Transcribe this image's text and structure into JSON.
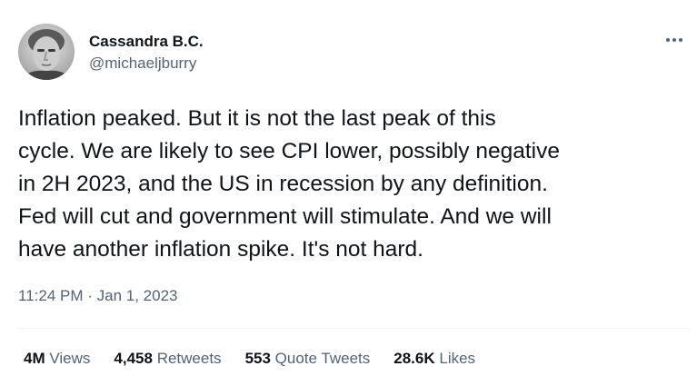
{
  "author": {
    "display_name": "Cassandra B.C.",
    "handle": "@michaeljburry",
    "avatar_icon": "user-photo-avatar"
  },
  "menu": {
    "icon": "more-dots-icon"
  },
  "tweet": {
    "lines": [
      "Inflation peaked. But it is not the last peak of this",
      "cycle. We are likely to see CPI lower, possibly negative",
      "in 2H 2023, and the US in recession by any definition.",
      "Fed will cut and government will stimulate. And we will",
      "have another inflation spike. It's not hard."
    ],
    "time": "11:24 PM",
    "separator": " · ",
    "date": "Jan 1, 2023"
  },
  "stats": {
    "views": {
      "count": "4M",
      "label": "Views"
    },
    "retweets": {
      "count": "4,458",
      "label": "Retweets"
    },
    "quotes": {
      "count": "553",
      "label": "Quote Tweets"
    },
    "likes": {
      "count": "28.6K",
      "label": "Likes"
    }
  },
  "colors": {
    "text_primary": "#0f1419",
    "text_secondary": "#536471",
    "divider": "#eff3f4"
  }
}
